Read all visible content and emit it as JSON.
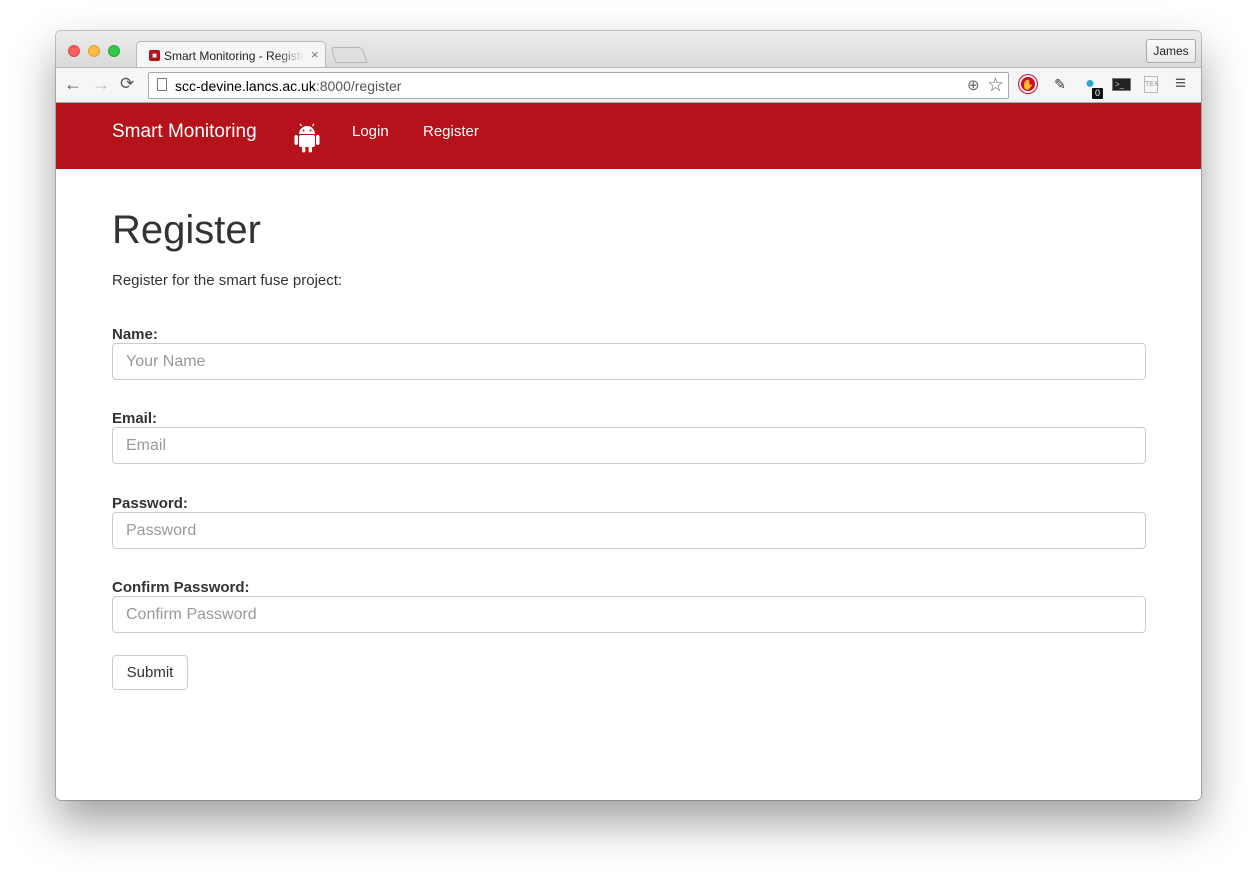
{
  "browser": {
    "tab_title": "Smart Monitoring - Register",
    "tab_close": "×",
    "profile_name": "James",
    "url_host": "scc-devine.lancs.ac.uk",
    "url_rest": ":8000/register",
    "ghost_badge": "0",
    "tex_label": "TEX",
    "icons": {
      "back": "←",
      "forward": "→",
      "reload": "⟳",
      "zoom": "⊕",
      "star": "☆",
      "menu": "≡",
      "stop": "✋",
      "dropper": "✎",
      "ghost": "●",
      "terminal": ">_"
    }
  },
  "navbar": {
    "brand": "Smart Monitoring",
    "links": [
      "Login",
      "Register"
    ],
    "color": "#b5121b"
  },
  "page": {
    "title": "Register",
    "subtitle": "Register for the smart fuse project:"
  },
  "form": {
    "name": {
      "label": "Name:",
      "placeholder": "Your Name",
      "value": ""
    },
    "email": {
      "label": "Email:",
      "placeholder": "Email",
      "value": ""
    },
    "password": {
      "label": "Password:",
      "placeholder": "Password",
      "value": ""
    },
    "confirm": {
      "label": "Confirm Password:",
      "placeholder": "Confirm Password",
      "value": ""
    },
    "submit_label": "Submit"
  }
}
